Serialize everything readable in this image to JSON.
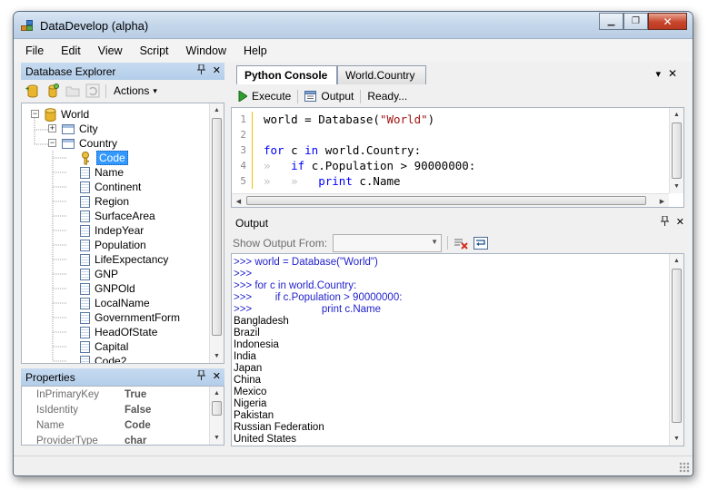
{
  "window": {
    "title": "DataDevelop (alpha)",
    "controls": {
      "minimize": "▁",
      "restore": "❐",
      "close": "✕"
    }
  },
  "menubar": {
    "items": [
      "File",
      "Edit",
      "View",
      "Script",
      "Window",
      "Help"
    ]
  },
  "database_explorer": {
    "title": "Database Explorer",
    "pin": "📌",
    "close": "✕",
    "toolbar": {
      "actions_label": "Actions",
      "actions_arrow": "▾"
    },
    "tree": {
      "root": {
        "label": "World",
        "state": "expanded"
      },
      "tables": [
        {
          "label": "City",
          "state": "collapsed"
        },
        {
          "label": "Country",
          "state": "expanded"
        }
      ],
      "country_columns": [
        "Code",
        "Name",
        "Continent",
        "Region",
        "SurfaceArea",
        "IndepYear",
        "Population",
        "LifeExpectancy",
        "GNP",
        "GNPOld",
        "LocalName",
        "GovernmentForm",
        "HeadOfState",
        "Capital",
        "Code2"
      ],
      "selected_column": "Code"
    }
  },
  "properties": {
    "title": "Properties",
    "rows": [
      {
        "name": "InPrimaryKey",
        "value": "True"
      },
      {
        "name": "IsIdentity",
        "value": "False"
      },
      {
        "name": "Name",
        "value": "Code"
      },
      {
        "name": "ProviderType",
        "value": "char"
      }
    ]
  },
  "tabs": [
    {
      "label": "Python Console",
      "active": true
    },
    {
      "label": "World.Country",
      "active": false
    }
  ],
  "tabstrip_controls": {
    "dropdown": "▾",
    "close": "✕"
  },
  "console_toolbar": {
    "execute": "Execute",
    "output": "Output",
    "status": "Ready..."
  },
  "editor": {
    "lines": [
      {
        "num": "1",
        "tokens": [
          {
            "t": "world = Database(",
            "c": "plain"
          },
          {
            "t": "\"World\"",
            "c": "string"
          },
          {
            "t": ")",
            "c": "plain"
          }
        ]
      },
      {
        "num": "2",
        "tokens": []
      },
      {
        "num": "3",
        "tokens": [
          {
            "t": "for",
            "c": "keyword"
          },
          {
            "t": " c ",
            "c": "plain"
          },
          {
            "t": "in",
            "c": "keyword"
          },
          {
            "t": " world.Country:",
            "c": "plain"
          }
        ]
      },
      {
        "num": "4",
        "tokens": [
          {
            "t": "»   ",
            "c": "ws"
          },
          {
            "t": "if",
            "c": "keyword"
          },
          {
            "t": " c.Population > 90000000:",
            "c": "plain"
          }
        ]
      },
      {
        "num": "5",
        "tokens": [
          {
            "t": "»   »   ",
            "c": "ws"
          },
          {
            "t": "print",
            "c": "keyword"
          },
          {
            "t": " c.Name",
            "c": "plain"
          }
        ]
      }
    ],
    "colors": {
      "keyword": "#0000ff",
      "string": "#a31515",
      "plain": "#000000",
      "ws": "#c0c0c0"
    }
  },
  "output": {
    "title": "Output",
    "show_output_from_label": "Show Output From:",
    "show_output_from_value": "",
    "lines": [
      {
        "text": ">>> world = Database(\"World\")",
        "kind": "prompt"
      },
      {
        "text": ">>>",
        "kind": "prompt"
      },
      {
        "text": ">>> for c in world.Country:",
        "kind": "prompt"
      },
      {
        "text": ">>>        if c.Population > 90000000:",
        "kind": "prompt"
      },
      {
        "text": ">>>                        print c.Name",
        "kind": "prompt"
      },
      {
        "text": "Bangladesh",
        "kind": "result"
      },
      {
        "text": "Brazil",
        "kind": "result"
      },
      {
        "text": "Indonesia",
        "kind": "result"
      },
      {
        "text": "India",
        "kind": "result"
      },
      {
        "text": "Japan",
        "kind": "result"
      },
      {
        "text": "China",
        "kind": "result"
      },
      {
        "text": "Mexico",
        "kind": "result"
      },
      {
        "text": "Nigeria",
        "kind": "result"
      },
      {
        "text": "Pakistan",
        "kind": "result"
      },
      {
        "text": "Russian Federation",
        "kind": "result"
      },
      {
        "text": "United States",
        "kind": "result"
      }
    ]
  }
}
